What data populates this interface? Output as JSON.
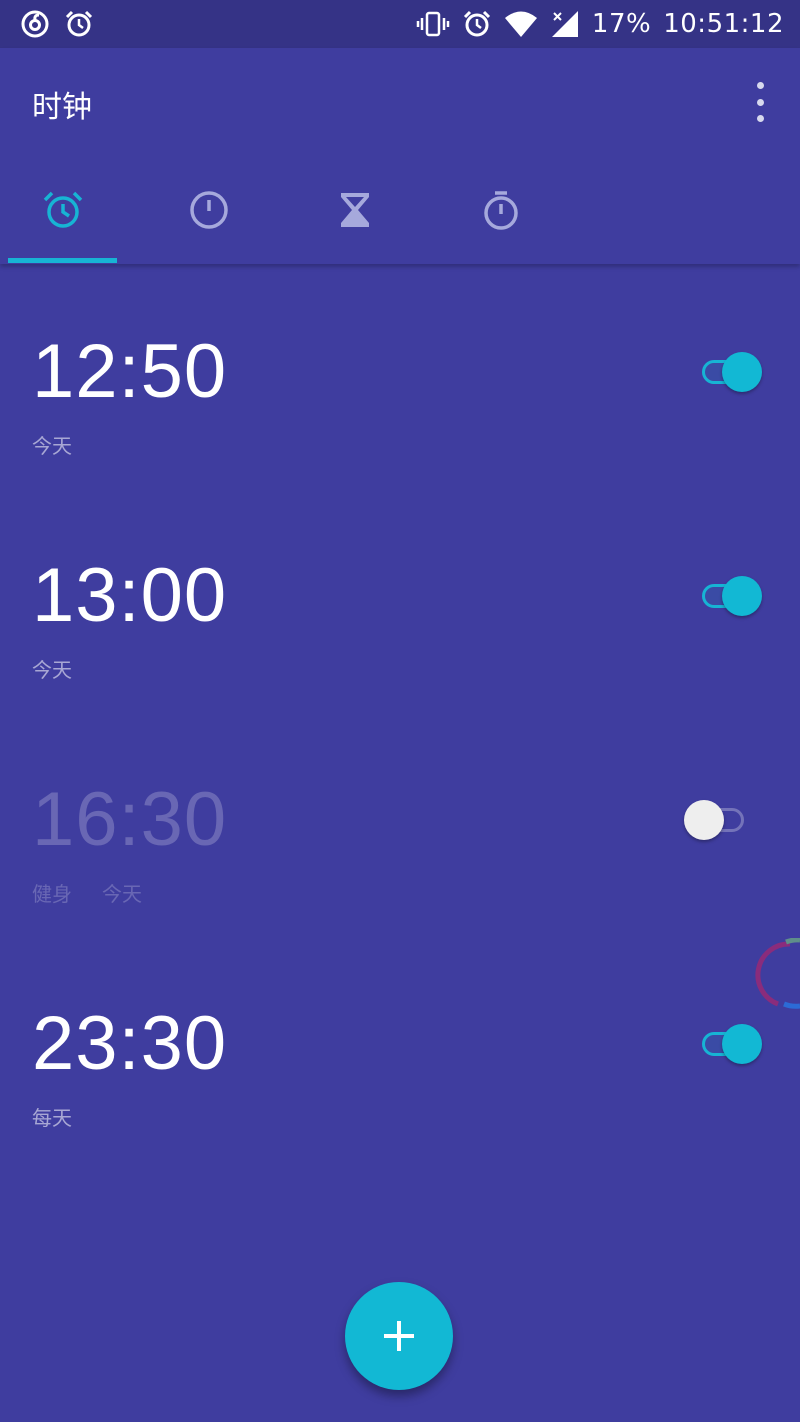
{
  "status_bar": {
    "left_icons": [
      "netease-music-icon",
      "alarm-clock-icon"
    ],
    "right_icons": [
      "vibrate-icon",
      "alarm-clock-icon",
      "wifi-icon",
      "signal-icon"
    ],
    "battery": "17%",
    "time": "10:51:12"
  },
  "app_bar": {
    "title": "时钟",
    "overflow_icon": "more-vert-icon"
  },
  "tabs": [
    {
      "icon": "alarm-icon",
      "selected": true
    },
    {
      "icon": "clock-icon",
      "selected": false
    },
    {
      "icon": "hourglass-icon",
      "selected": false
    },
    {
      "icon": "stopwatch-icon",
      "selected": false
    }
  ],
  "alarms": [
    {
      "time": "12:50",
      "label": "",
      "repeat": "今天",
      "enabled": true
    },
    {
      "time": "13:00",
      "label": "",
      "repeat": "今天",
      "enabled": true
    },
    {
      "time": "16:30",
      "label": "健身",
      "repeat": "今天",
      "enabled": false
    },
    {
      "time": "23:30",
      "label": "",
      "repeat": "每天",
      "enabled": true
    }
  ],
  "fab": {
    "icon": "plus-icon"
  },
  "colors": {
    "background": "#3f3d9f",
    "status_bar": "#353386",
    "accent": "#12b8d4",
    "toggle_off_thumb": "#eeeeee"
  }
}
